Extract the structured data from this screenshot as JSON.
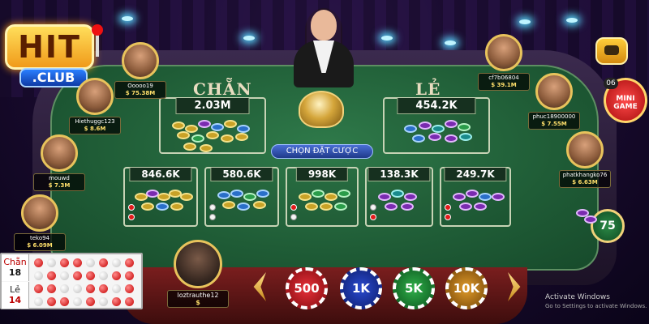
{
  "logo": {
    "hit": "HIT",
    "club": ".CLUB"
  },
  "table": {
    "chan_label": "CHẴN",
    "le_label": "LẺ",
    "chan_total": "2.03M",
    "le_total": "454.2K",
    "pick_button": "CHỌN ĐẶT CƯỢC",
    "sub_bets": [
      "846.6K",
      "580.6K",
      "998K",
      "138.3K",
      "249.7K"
    ]
  },
  "players": [
    {
      "name": "Ooooo19",
      "money": "$ 75.38M"
    },
    {
      "name": "Hiethuggc123",
      "money": "$ 8.6M"
    },
    {
      "name": "mouwd",
      "money": "$ 7.3M"
    },
    {
      "name": "teko94",
      "money": "$ 6.09M"
    },
    {
      "name": "cf7b06804",
      "money": "$ 39.1M"
    },
    {
      "name": "phuc18900000",
      "money": "$ 7.55M"
    },
    {
      "name": "phatkhangko76",
      "money": "$ 6.63M"
    }
  ],
  "you": {
    "name": "loztrauthe12",
    "money": "$"
  },
  "side": {
    "mini_count": "06",
    "mini_label_1": "MINI",
    "mini_label_2": "GAME",
    "timer": "75"
  },
  "history": {
    "chan_label": "Chẵn",
    "chan_count": "18",
    "le_label": "Lẻ",
    "le_count": "14"
  },
  "bet_chips": [
    "500",
    "1K",
    "5K",
    "10K"
  ],
  "watermark": {
    "line1": "Activate Windows",
    "line2": "Go to Settings to activate Windows."
  },
  "colors": {
    "felt": "#1f5c36",
    "gold": "#e8c35c",
    "chip_500": "#e8313a",
    "chip_1k": "#2a4bd0",
    "chip_5k": "#2fb04a",
    "chip_10k": "#e09b2a"
  }
}
